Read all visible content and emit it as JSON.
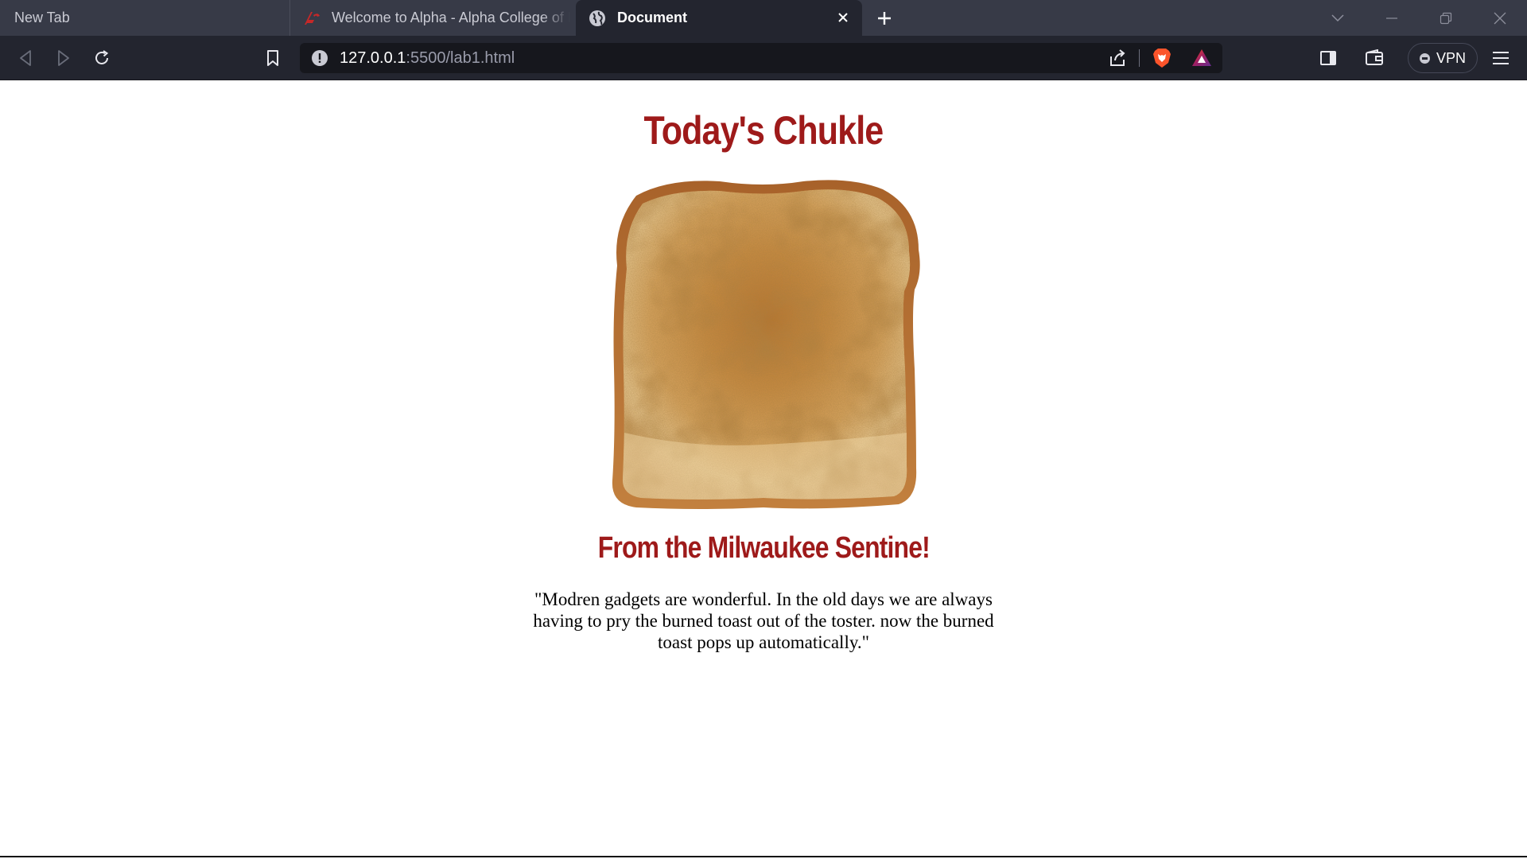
{
  "browser": {
    "tabs": [
      {
        "label": "New Tab",
        "active": false
      },
      {
        "label": "Welcome to Alpha - Alpha College of E",
        "active": false,
        "favicon": "alpha-college-logo"
      },
      {
        "label": "Document",
        "active": true,
        "favicon": "globe-icon"
      }
    ],
    "url": {
      "host": "127.0.0.1",
      "rest": ":5500/lab1.html"
    },
    "vpn_label": "VPN",
    "colors": {
      "tabstrip": "#373a47",
      "toolbar": "#23252f",
      "urlbar": "#16171d"
    }
  },
  "page": {
    "title": "Today's Chukle",
    "image": "burnt-toast-image",
    "subtitle": "From the Milwaukee Sentine!",
    "quote": "\"Modren gadgets are wonderful. In the old days we are always having to pry the burned toast out of the toster. now the burned toast pops up automatically.\"",
    "colors": {
      "heading": "#9e1a1a",
      "text": "#000000"
    }
  }
}
